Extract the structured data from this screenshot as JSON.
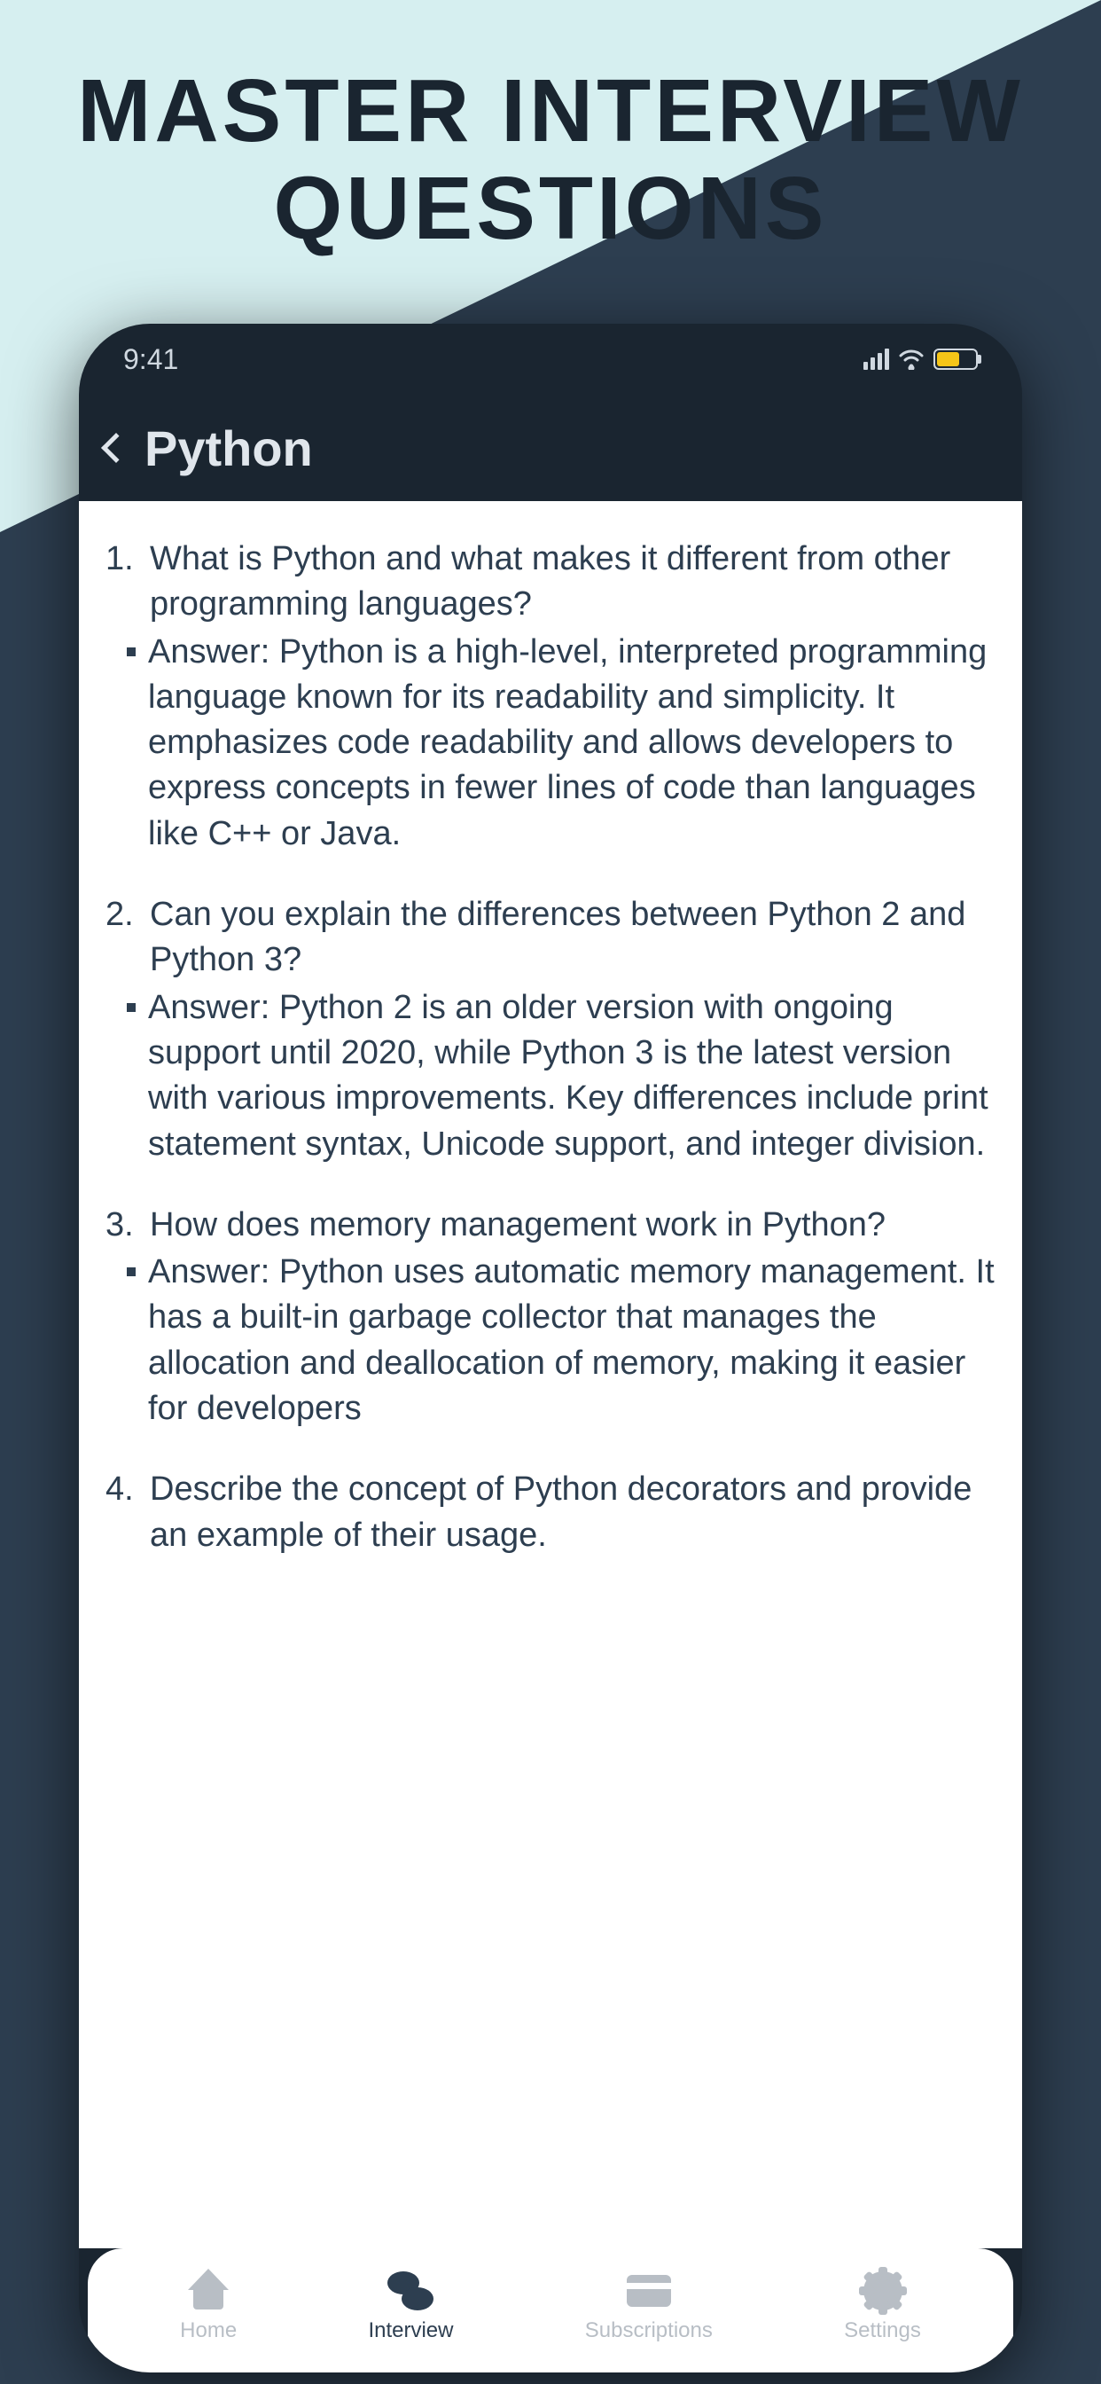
{
  "headline_line1": "MASTER INTERVIEW",
  "headline_line2": "QUESTIONS",
  "status": {
    "time": "9:41"
  },
  "header": {
    "title": "Python"
  },
  "qa": [
    {
      "num": "1.",
      "question": "What is Python and what makes it different from other programming languages?",
      "answer": "Answer: Python is a high-level, interpreted programming language known for its readability and simplicity. It emphasizes code readability and allows developers to express concepts in fewer lines of code than languages like C++ or Java."
    },
    {
      "num": "2.",
      "question": "Can you explain the differences between Python 2 and Python 3?",
      "answer": "Answer: Python 2 is an older version with ongoing support until 2020, while Python 3 is the latest version with various improvements. Key differences include print statement syntax, Unicode support, and integer division."
    },
    {
      "num": "3.",
      "question": "How does memory management work in Python?",
      "answer": "Answer: Python uses automatic memory management. It has a built-in garbage collector that manages the allocation and deallocation of memory, making it easier for developers"
    },
    {
      "num": "4.",
      "question": "Describe the concept of Python decorators and provide an example of their usage.",
      "answer": ""
    }
  ],
  "nav": {
    "home": "Home",
    "interview": "Interview",
    "subscriptions": "Subscriptions",
    "settings": "Settings"
  }
}
